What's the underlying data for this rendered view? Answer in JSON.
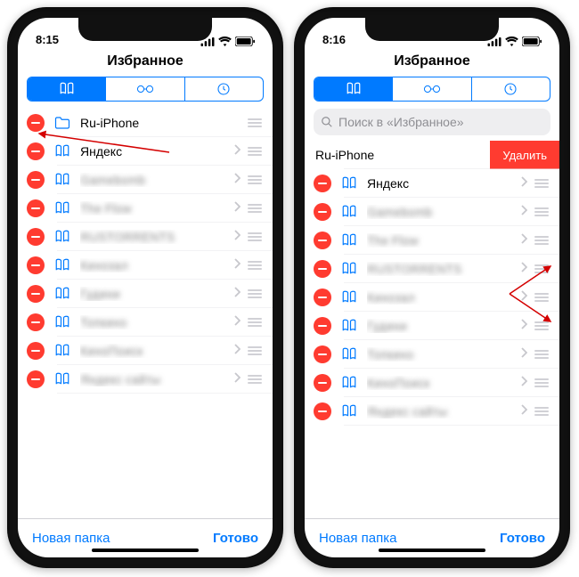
{
  "phones": [
    {
      "time": "8:15",
      "title": "Избранное",
      "search_placeholder": "",
      "show_search": false,
      "items": [
        {
          "label": "Ru-iPhone",
          "icon": "folder",
          "blurred": false,
          "chevron": false,
          "swiped": false
        },
        {
          "label": "Яндекс",
          "icon": "book",
          "blurred": false,
          "chevron": true,
          "swiped": false
        },
        {
          "label": "Gamebomb",
          "icon": "book",
          "blurred": true,
          "chevron": true,
          "swiped": false
        },
        {
          "label": "The Flow",
          "icon": "book",
          "blurred": true,
          "chevron": true,
          "swiped": false
        },
        {
          "label": "RUSTORRENTS",
          "icon": "book",
          "blurred": true,
          "chevron": true,
          "swiped": false
        },
        {
          "label": "Кинозал",
          "icon": "book",
          "blurred": true,
          "chevron": true,
          "swiped": false
        },
        {
          "label": "Гудини",
          "icon": "book",
          "blurred": true,
          "chevron": true,
          "swiped": false
        },
        {
          "label": "Топкино",
          "icon": "book",
          "blurred": true,
          "chevron": true,
          "swiped": false
        },
        {
          "label": "КиноПоиск",
          "icon": "book",
          "blurred": true,
          "chevron": true,
          "swiped": false
        },
        {
          "label": "Яндекс сайты",
          "icon": "book",
          "blurred": true,
          "chevron": true,
          "swiped": false
        }
      ],
      "toolbar": {
        "left": "Новая папка",
        "right": "Готово"
      }
    },
    {
      "time": "8:16",
      "title": "Избранное",
      "search_placeholder": "Поиск в «Избранное»",
      "show_search": true,
      "items": [
        {
          "label": "Ru-iPhone",
          "icon": "",
          "blurred": false,
          "chevron": false,
          "swiped": true,
          "delete_label": "Удалить"
        },
        {
          "label": "Яндекс",
          "icon": "book",
          "blurred": false,
          "chevron": true,
          "swiped": false
        },
        {
          "label": "Gamebomb",
          "icon": "book",
          "blurred": true,
          "chevron": true,
          "swiped": false
        },
        {
          "label": "The Flow",
          "icon": "book",
          "blurred": true,
          "chevron": true,
          "swiped": false
        },
        {
          "label": "RUSTORRENTS",
          "icon": "book",
          "blurred": true,
          "chevron": true,
          "swiped": false
        },
        {
          "label": "Кинозал",
          "icon": "book",
          "blurred": true,
          "chevron": true,
          "swiped": false
        },
        {
          "label": "Гудини",
          "icon": "book",
          "blurred": true,
          "chevron": true,
          "swiped": false
        },
        {
          "label": "Топкино",
          "icon": "book",
          "blurred": true,
          "chevron": true,
          "swiped": false
        },
        {
          "label": "КиноПоиск",
          "icon": "book",
          "blurred": true,
          "chevron": true,
          "swiped": false
        },
        {
          "label": "Яндекс сайты",
          "icon": "book",
          "blurred": true,
          "chevron": true,
          "swiped": false
        }
      ],
      "toolbar": {
        "left": "Новая папка",
        "right": "Готово"
      }
    }
  ]
}
